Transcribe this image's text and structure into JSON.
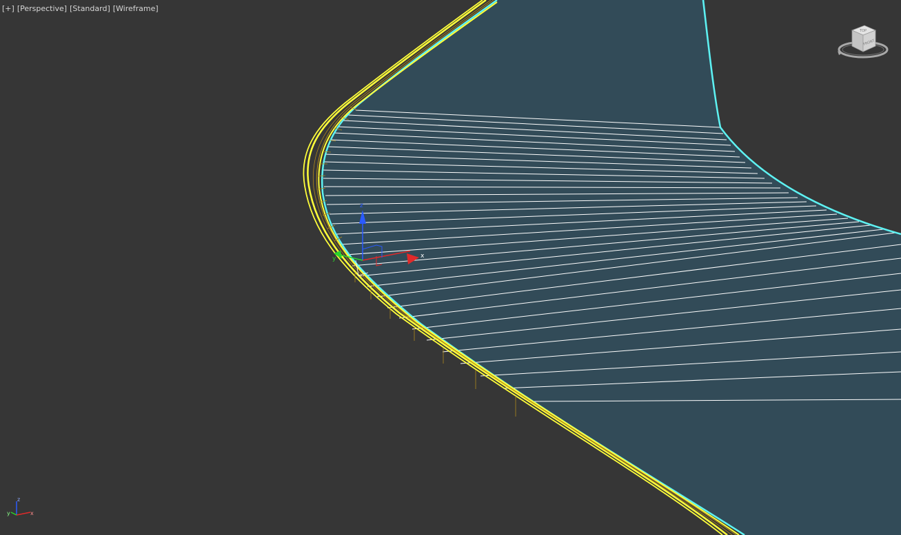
{
  "viewport": {
    "labels": {
      "menu": "[+]",
      "view": "[Perspective]",
      "shading_preset": "[Standard]",
      "shading_mode": "[Wireframe]"
    },
    "viewcube": {
      "face_top": "TOP",
      "face_front": "FRONT"
    },
    "gizmo": {
      "x": "x",
      "y": "y",
      "z": "z"
    },
    "world_axis": {
      "x": "x",
      "y": "y",
      "z": "z"
    }
  },
  "colors": {
    "background": "#363636",
    "surface": "#324b58",
    "selected": "#ffff3a",
    "selected_mesh": "#b08a1c",
    "surface_edge": "#5ef2f2",
    "mesh_lines": "#ffffff",
    "axis_x": "#e02a2a",
    "axis_y": "#2ad42a",
    "axis_z": "#2a5aff"
  }
}
